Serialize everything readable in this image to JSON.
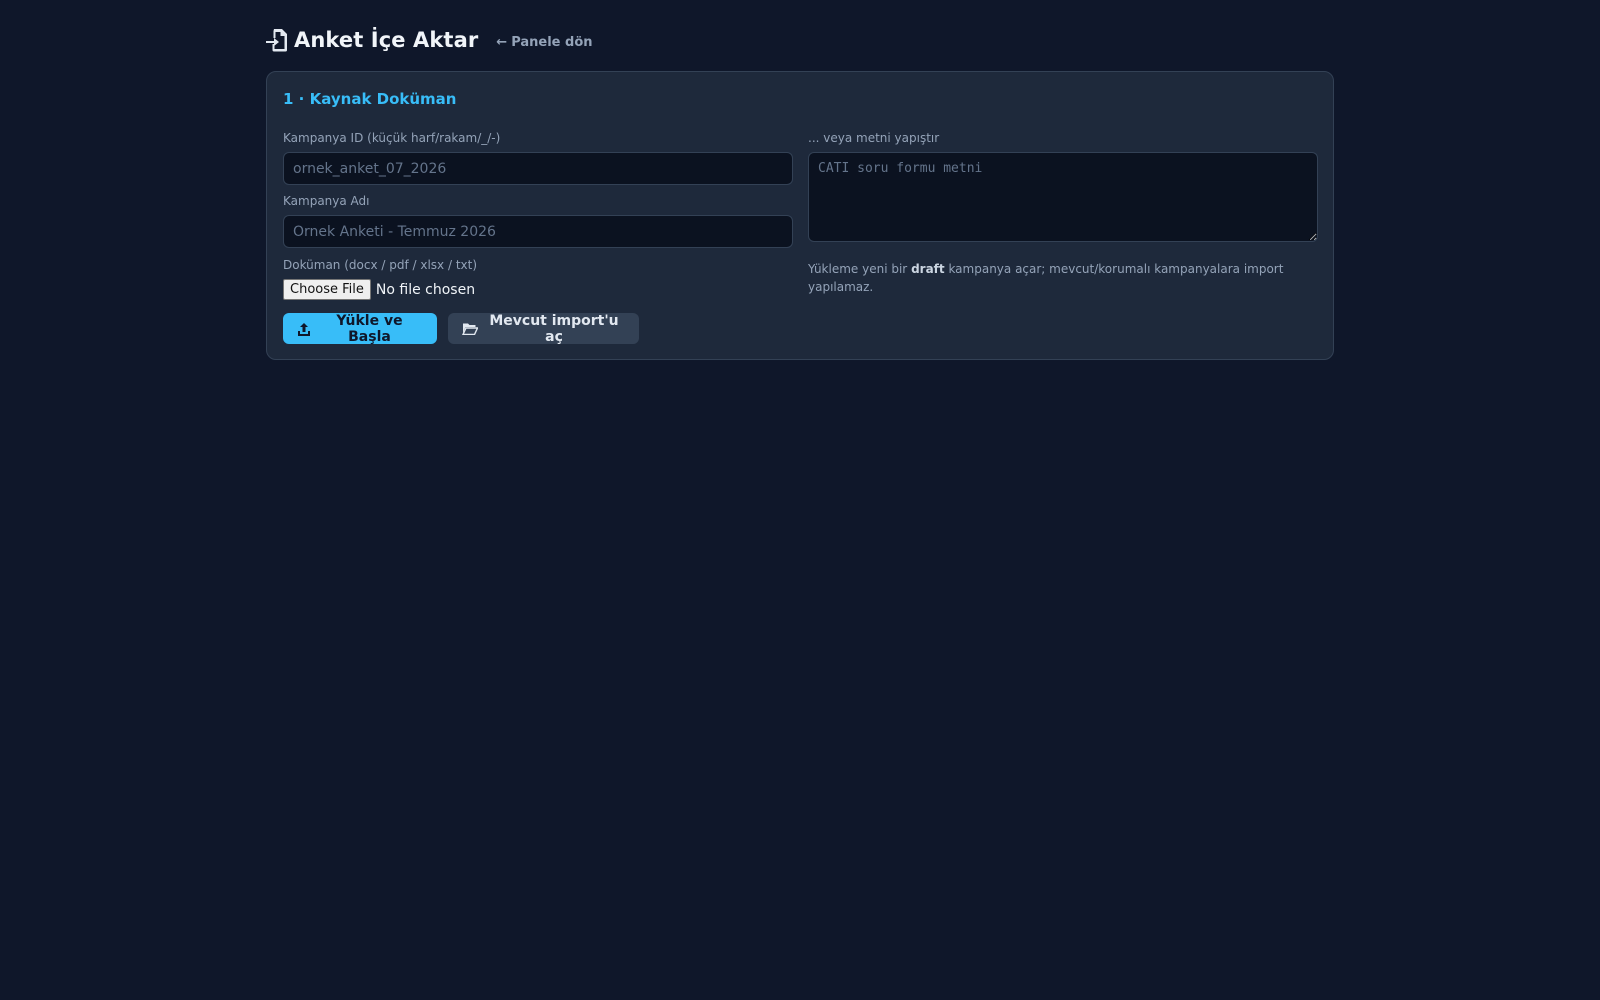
{
  "header": {
    "title": "Anket İçe Aktar",
    "back_label": "Panele dön",
    "title_icon": "file-import-icon",
    "back_icon": "arrow-left-icon"
  },
  "card": {
    "title": "1 · Kaynak Doküman",
    "campaign_id": {
      "label": "Kampanya ID (küçük harf/rakam/_/-)",
      "placeholder": "ornek_anket_07_2026",
      "value": ""
    },
    "campaign_name": {
      "label": "Kampanya Adı",
      "placeholder": "Ornek Anketi - Temmuz 2026",
      "value": ""
    },
    "document": {
      "label": "Doküman (docx / pdf / xlsx / txt)",
      "choose_label": "Choose File",
      "status": "No file chosen"
    },
    "paste": {
      "label": "... veya metni yapıştır",
      "placeholder": "CATI soru formu metni"
    },
    "note": {
      "before": "Yükleme yeni bir ",
      "bold": "draft",
      "after": " kampanya açar; mevcut/korumalı kampanyalara import yapılamaz."
    },
    "buttons": {
      "upload_label": "Yükle ve Başla",
      "upload_icon": "upload-icon",
      "open_existing_label": "Mevcut import'u aç",
      "open_existing_icon": "folder-open-icon"
    }
  },
  "colors": {
    "background": "#0f172a",
    "card": "#1e293b",
    "accent": "#38bdf8",
    "secondary_button": "#334155"
  }
}
